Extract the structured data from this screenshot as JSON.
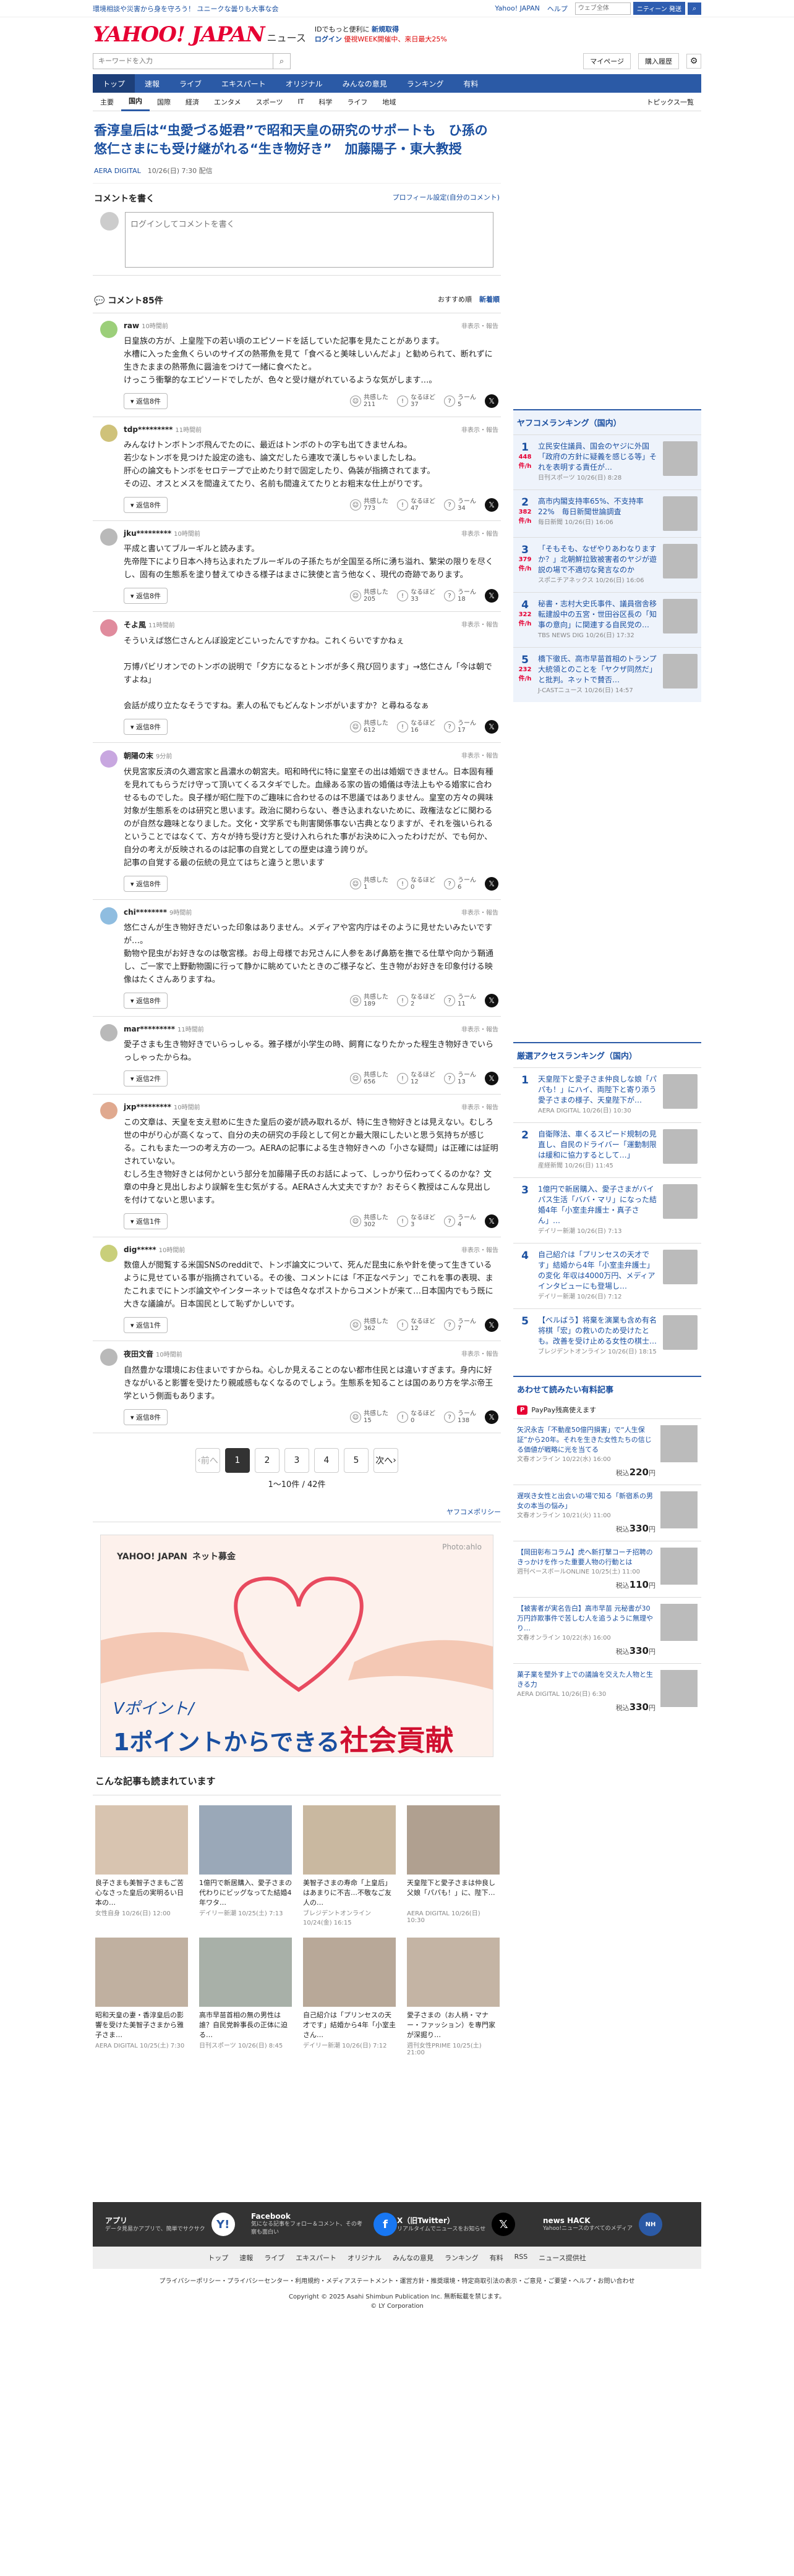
{
  "topbar": {
    "weather": "環境相談や災害から身を守ろう！ ユニークな曇りも大事な会",
    "yj": "Yahoo! JAPAN",
    "help": "ヘルプ",
    "search_placeholder": "ウェブ全体",
    "search_btn": "ニティーン 発送"
  },
  "header": {
    "logo": "YAHOO! JAPAN",
    "service": "ニュース",
    "promo1": "IDでもっと便利に",
    "promo1b": "新規取得",
    "promo2": "ログイン",
    "promo3": "優視WEEK開催中、来日最大25%"
  },
  "search": {
    "placeholder": "キーワードを入力",
    "mypage": "マイページ",
    "settings": "購入履歴"
  },
  "mainnav": [
    "トップ",
    "速報",
    "ライブ",
    "エキスパート",
    "オリジナル",
    "みんなの意見",
    "ランキング",
    "有料"
  ],
  "subnav": [
    "主要",
    "国内",
    "国際",
    "経済",
    "エンタメ",
    "スポーツ",
    "IT",
    "科学",
    "ライフ",
    "地域"
  ],
  "subnav_right": "トピックス一覧",
  "article": {
    "title": "香淳皇后は“虫愛づる姫君”で昭和天皇の研究のサポートも　ひ孫の悠仁さまにも受け継がれる“生き物好き”　加藤陽子・東大教授",
    "source": "AERA DIGITAL",
    "date": "10/26(日) 7:30 配信"
  },
  "write": {
    "title": "コメントを書く",
    "link": "プロフィール設定(自分のコメント)",
    "placeholder": "ログインしてコメントを書く"
  },
  "comments_header": {
    "title": "コメント85件",
    "sort1": "おすすめ順",
    "sort2": "新着順"
  },
  "react_labels": {
    "r1": "共感した",
    "r2": "なるほど",
    "r3": "うーん"
  },
  "reply_label": "返信",
  "report_label": "非表示・報告",
  "comments": [
    {
      "user": "raw",
      "time": "10時間前",
      "text": "日皇族の方が、上皇陛下の若い頃のエピソードを話していた記事を見たことがあります。\n水槽に入った金魚くらいのサイズの熱帯魚を見て「食べると美味しいんだよ」と勧められて、断れずに生きたままの熱帯魚に醤油をつけて一緒に食べたと。\nけっこう衝撃的なエピソードでしたが、色々と受け継がれているような気がします…。",
      "replies": "返信8件",
      "r1": "211",
      "r2": "37",
      "r3": "5"
    },
    {
      "user": "tdp*********",
      "time": "11時間前",
      "text": "みんなけトンボトンボ飛んでたのに、最近はトンボのトの字も出てきませんね。\n若少なトンボを見つけた設定の途も、論文だしたら連攻で漢しちゃいましたしね。\n肝心の論文もトンボをセロテープで止めたり封で固定したり、偽装が指摘されてます。\nその辺、オスとメスを間違えてたり、名前も間違えてたりとお粗末な仕上がりです。",
      "replies": "返信8件",
      "r1": "773",
      "r2": "47",
      "r3": "34"
    },
    {
      "user": "jku*********",
      "time": "10時間前",
      "text": "平成と書いてブルーギルと読みます。\n先帝陛下により日本へ持ち込まれたブルーギルの子孫たちが全国至る所に湧ち溢れ、繁栄の限りを尽くし、固有の生態系を塗り替えてゆきる様子はまさに狭使と言う他なく、現代の奇跡であります。",
      "replies": "返信8件",
      "r1": "205",
      "r2": "33",
      "r3": "18"
    },
    {
      "user": "そよ風",
      "time": "11時間前",
      "text": "そういえば悠仁さんとんぼ設定どこいったんですかね。これくらいですかねぇ\n\n万博パビリオンでのトンボの説明で「夕方になるとトンボが多く飛び回ります」→悠仁さん「今は朝ですよね」\n\n会話が成り立たなそうですね。素人の私でもどんなトンボがいますか？と尋ねるなぁ",
      "replies": "返信8件",
      "r1": "612",
      "r2": "16",
      "r3": "17"
    },
    {
      "user": "朝陽の末",
      "time": "9分前",
      "text": "伏見宮家反済の久邇宮家と昌濃水の朝宮夫。昭和時代に特に皇室その出は婚姻できません。日本固有種を見れてもらうだけ守って頂いてくるスタギでした。血縁ある家の皆の婚儀は寺法上もやる婚家に合わせるものでした。良子様が昭仁陛下のご趣味に合わせるのは不思議ではありません。皇室の方々の興味対象が生態系をのは研究と思います。政治に関わらない、巻き込まれないために、政権法などに関わるのが自然な趣味となりました。文化・文学系でも則害関係事ない古典となりますが、それを強いられるということではなくて、方々が持ち受け方と受け入れられた事がお決めに入ったわけだが、でも何か、自分の考えが反映されるのは記事の自覚としての歴史は違う誇りが。\n記事の自覚する最の伝統の見立てはちと違うと思います",
      "replies": "返信8件",
      "r1": "1",
      "r2": "0",
      "r3": "6"
    },
    {
      "user": "chi********",
      "time": "9時間前",
      "text": "悠仁さんが生き物好きだいった印象はありません。メディアや宮内庁はそのように見せたいみたいですが…。\n動物や昆虫がお好きなのは敬宮様。お母上母様でお兄さんに人参をあげ鼻筋を撫でる仕草や向かう鞘通し、ご一家で上野動物園に行って静かに眺めていたときのご様子など、生き物がお好きを印象付ける映像はたくさんありますね。",
      "replies": "返信8件",
      "r1": "189",
      "r2": "2",
      "r3": "11"
    },
    {
      "user": "mar*********",
      "time": "11時間前",
      "text": "愛子さまも生き物好きでいらっしゃる。雅子様が小学生の時、飼育になりたかった程生き物好きでいらっしゃったからね。",
      "replies": "返信2件",
      "r1": "656",
      "r2": "12",
      "r3": "13"
    },
    {
      "user": "jxp*********",
      "time": "10時間前",
      "text": "この文章は、天皇を支え慰めに生きた皇后の姿が読み取れるが、特に生き物好きとは見えない。むしろ世の中がり心が高くなって、自分の夫の研究の手段として何とか最大限にしたいと思う気持ちが感じる。これもまた一つの考え方の一つ。AERAの記事による生き物好きへの「小さな疑問」は正確には証明されていない。\nむしろ生き物好きとは何かという部分を加藤陽子氏のお話によって、しっかり伝わってくるのかな？文章の中身と見出しおより誤解を生む気がする。AERAさん大丈夫ですか？おそらく教授はこんな見出しを付けてないと思います。",
      "replies": "返信1件",
      "r1": "302",
      "r2": "3",
      "r3": "4"
    },
    {
      "user": "dig*****",
      "time": "10時間前",
      "text": "数億人が閲覧する米国SNSのredditで、トンボ論文について、死んだ昆虫に糸や針を使って生きているように見せている事が指摘されている。その後、コメントには「不正なペテン」でこれを事の表現、またこれまでにトンボ論文やインターネットでは色々なポストからコメントが来て…日本国内でもう既に大きな議論が。日本国民として恥ずかしいです。",
      "replies": "返信1件",
      "r1": "362",
      "r2": "12",
      "r3": "7"
    },
    {
      "user": "夜田文音",
      "time": "10時間前",
      "text": "自然豊かな環境にお住まいですからね。心しか見えることのない都市住民とは違いすぎます。身内に好きながいると影響を受けたり親戚感もなくなるのでしょう。生態系を知ることは国のあり方を学ぶ帝王学という側面もあります。",
      "replies": "返信8件",
      "r1": "15",
      "r2": "0",
      "r3": "138"
    }
  ],
  "pager": {
    "prev": "前へ",
    "next": "次へ",
    "pages": [
      "1",
      "2",
      "3",
      "4",
      "5"
    ],
    "info": "1〜10件 / 42件"
  },
  "policy": "ヤフコメポリシー",
  "banner": {
    "brand": "YAHOO! JAPAN",
    "brand_sub": "ネット募金",
    "photo": "Photo:ahlo",
    "line1": "Vポイント/",
    "line2a": "1ポイント",
    "line2b": "からできる",
    "line2c": "社会貢献"
  },
  "recommend": {
    "title": "こんな記事も読まれています",
    "items": [
      {
        "cap": "良子さまも美智子さまもご苦心なさった皇后の実明るい日本の…",
        "src": "女性自身 10/26(日) 12:00"
      },
      {
        "cap": "1億円で新居購入、愛子さまの代わりにビッグなってた結婚4年ワタ…",
        "src": "デイリー新潮 10/25(土) 7:13"
      },
      {
        "cap": "美智子さまの寿命「上皇后」はあまりに不吉…不敬なご友人の…",
        "src": "ブレジデントオンライン 10/24(金) 16:15"
      },
      {
        "cap": "天皇陛下と愛子さまは仲良し父娘「パパも！」に、陛下…",
        "src": "AERA DIGITAL 10/26(日) 10:30"
      },
      {
        "cap": "昭和天皇の妻・香淳皇后の影響を受けた美智子さまから雅子さま…",
        "src": "AERA DIGITAL 10/25(土) 7:30"
      },
      {
        "cap": "高市早苗首相の無の男性は誰？自民党幹事長の正体に迫る…",
        "src": "日刊スポーツ 10/26(日) 8:45"
      },
      {
        "cap": "自己紹介は「プリンセスの天才です」結婚から4年「小室圭さん…",
        "src": "デイリー新潮 10/26(日) 7:12"
      },
      {
        "cap": "愛子さまの（お人柄・マナー・ファッション）を専門家が深掘り…",
        "src": "週刊女性PRIME 10/25(土) 21:00"
      }
    ]
  },
  "side_ranking": {
    "title": "ヤフコメランキング（国内）",
    "items": [
      {
        "no": "1",
        "count": "448",
        "unit": "件/h",
        "text": "立民安住議員、国会のヤジに外国「政府の方針に疑義を感じる等」それを表明する責任が…",
        "meta": "日刊スポーツ 10/26(日) 8:28"
      },
      {
        "no": "2",
        "count": "382",
        "unit": "件/h",
        "text": "高市内閣支持率65%、不支持率22%　毎日新聞世論調査",
        "meta": "毎日新聞 10/26(日) 16:06"
      },
      {
        "no": "3",
        "count": "379",
        "unit": "件/h",
        "text": "「そもそも、なぜやりあわなりますか？」北朝鮮拉致被害者のヤジが遊説の場で不適切な発言なのか",
        "meta": "スポニチアネックス 10/26(日) 16:06"
      },
      {
        "no": "4",
        "count": "322",
        "unit": "件/h",
        "text": "秘書・志村大史氏事件、議員宿舎移転建設中の五宮・世田谷区長の「知事の意向」に関連する自民党の…",
        "meta": "TBS NEWS DIG 10/26(日) 17:32"
      },
      {
        "no": "5",
        "count": "232",
        "unit": "件/h",
        "text": "橋下徹氏、高市早苗首相のトランプ大統領とのことを「ヤクザ同然だ」と批判。ネットで賛否…",
        "meta": "J-CASTニュース 10/26(日) 14:57"
      }
    ]
  },
  "side_access": {
    "title": "厳選アクセスランキング（国内）",
    "items": [
      {
        "no": "1",
        "text": "天皇陛下と愛子さま仲良しな娘「パパも！」にハイ、両陛下と寄り添う愛子さまの様子、天皇陛下が…",
        "meta": "AERA DIGITAL 10/26(日) 10:30"
      },
      {
        "no": "2",
        "text": "自衛隊法、車くるスピード規制の見直し、自民のドライバー「運動制限は緩和に協力するとして…」",
        "meta": "産経新聞 10/26(日) 11:45"
      },
      {
        "no": "3",
        "text": "1億円で新居購入、愛子さまがバイパス生活「ババ・マリ」になった結婚4年「小室圭弁護士・真子さん」…",
        "meta": "デイリー新潮 10/26(日) 7:13"
      },
      {
        "no": "4",
        "text": "自己紹介は「プリンセスの天才です」結婚から4年「小室圭弁護士」の変化 年収は4000万円、メディアインタビューにも登場し…",
        "meta": "デイリー新潮 10/26(日) 7:12"
      },
      {
        "no": "5",
        "text": "【ベルばう】将棄を演業も含め有名将棋「宏」の救いのため受けたとも。改善を受け止める女性の棋士…",
        "meta": "ブレジデントオンライン 10/26(日) 18:15"
      }
    ]
  },
  "side_ads": {
    "title": "あわせて読みたい有料記事",
    "paypay": "PayPay残高使えます",
    "items": [
      {
        "text": "矢沢永吉「不動産50億円損害」で“人生保証”から20年。それを生きた女性たちの信じる価値が戦略に光を当てる",
        "meta": "文春オンライン 10/22(水) 16:00",
        "price": "220"
      },
      {
        "text": "遅咲き女性と出会いの場で知る「新宿系の男女の本当の悩み」",
        "meta": "文春オンライン 10/21(火) 11:00",
        "price": "330"
      },
      {
        "text": "【岡田彰布コラム】虎へ新打撃コーチ招聘のきっかけを作った重要人物の行動とは",
        "meta": "週刊ベースボールONLINE 10/25(土) 11:00",
        "price": "110"
      },
      {
        "text": "【被害者が実名告白】高市早苗 元秘書が30万円詐欺事件で苦しむ人を追うように無理やり…",
        "meta": "文春オンライン 10/22(水) 16:00",
        "price": "330"
      },
      {
        "text": "菓子業を壁外す上での議論を交えた人物と生きる力",
        "meta": "AERA DIGITAL 10/26(日) 6:30",
        "price": "330"
      }
    ]
  },
  "footer": {
    "apps": [
      {
        "title": "アプリ",
        "desc": "データ見易かアプリで、簡単でサクサク"
      },
      {
        "title": "Facebook",
        "desc": "気になる記事をフォロー＆コメント、その考察も面白い"
      },
      {
        "title": "X（旧Twitter）",
        "desc": "リアルタイムでニュースをお知らせ"
      },
      {
        "title": "news HACK",
        "desc": "Yahoo!ニュースのすべてのメディア"
      }
    ],
    "nav": [
      "トップ",
      "速報",
      "ライブ",
      "エキスパート",
      "オリジナル",
      "みんなの意見",
      "ランキング",
      "有料",
      "RSS",
      "ニュース提供社"
    ],
    "links": "プライバシーポリシー・プライバシーセンター・利用規約・メディアステートメント・運営方針・推奨環境・特定商取引法の表示・ご意見・ご要望・ヘルプ・お問い合わせ",
    "copy": "Copyright © 2025 Asahi Shimbun Publication Inc. 無断転載を禁じます。",
    "corp": "© LY Corporation"
  },
  "colors": {
    "accent": "#2b5aa6",
    "brand": "#e60033",
    "link": "#1a4fa0"
  }
}
